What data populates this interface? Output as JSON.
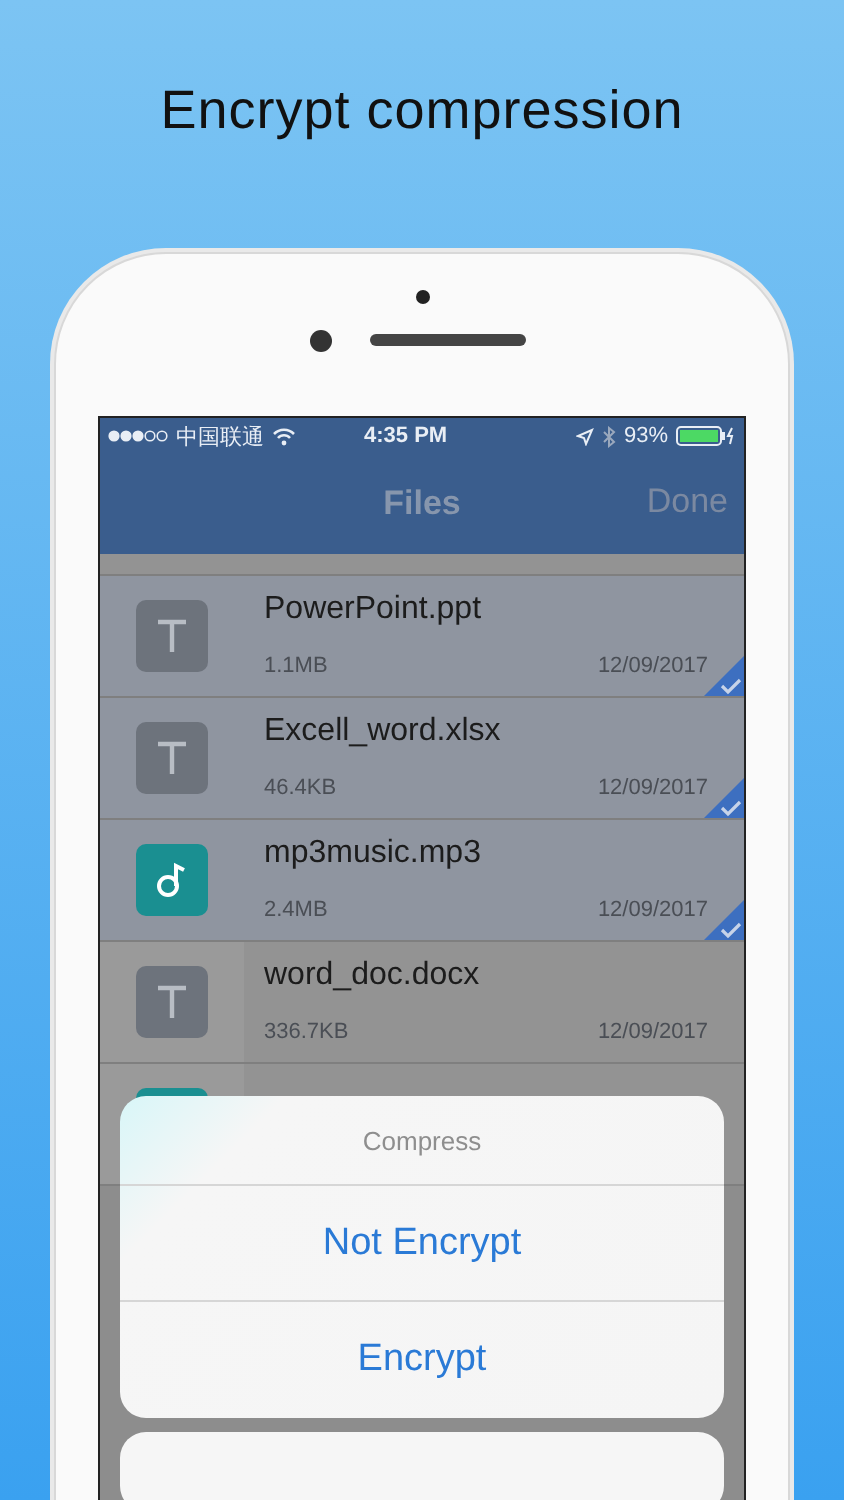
{
  "headline": "Encrypt compression",
  "status_bar": {
    "carrier": "中国联通",
    "time": "4:35 PM",
    "battery": "93%"
  },
  "nav": {
    "title": "Files",
    "action": "Done"
  },
  "files": [
    {
      "kind": "doc",
      "name": "PowerPoint.ppt",
      "size": "1.1MB",
      "date": "12/09/2017",
      "selected": true
    },
    {
      "kind": "doc",
      "name": "Excell_word.xlsx",
      "size": "46.4KB",
      "date": "12/09/2017",
      "selected": true
    },
    {
      "kind": "music",
      "name": "mp3music.mp3",
      "size": "2.4MB",
      "date": "12/09/2017",
      "selected": true
    },
    {
      "kind": "doc",
      "name": "word_doc.docx",
      "size": "336.7KB",
      "date": "12/09/2017",
      "selected": false
    },
    {
      "kind": "music",
      "selected": false
    }
  ],
  "action_sheet": {
    "title": "Compress",
    "options": [
      "Not Encrypt",
      "Encrypt"
    ]
  }
}
